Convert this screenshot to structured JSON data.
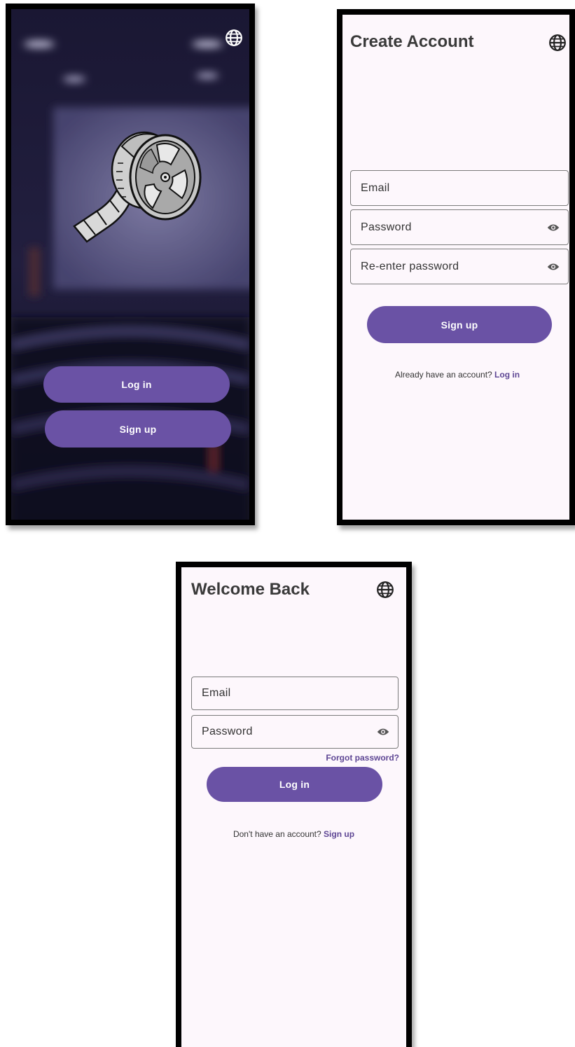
{
  "welcome_screen": {
    "login_button": "Log in",
    "signup_button": "Sign up",
    "language_icon": "globe-icon",
    "logo_icon": "film-reel-icon"
  },
  "signup_screen": {
    "title": "Create Account",
    "language_icon": "globe-icon",
    "email_label": "Email",
    "password_label": "Password",
    "reenter_password_label": "Re-enter password",
    "signup_button": "Sign up",
    "footer_text": "Already have an account?",
    "footer_link": "Log in"
  },
  "login_screen": {
    "title": "Welcome Back",
    "language_icon": "globe-icon",
    "email_label": "Email",
    "password_label": "Password",
    "forgot_password": "Forgot password?",
    "login_button": "Log in",
    "footer_text": "Don't have an account?",
    "footer_link": "Sign up"
  },
  "colors": {
    "accent": "#6a52a5",
    "link": "#5e4694",
    "screen_background": "#fdf7fc",
    "cinema_background": "#17142e"
  }
}
